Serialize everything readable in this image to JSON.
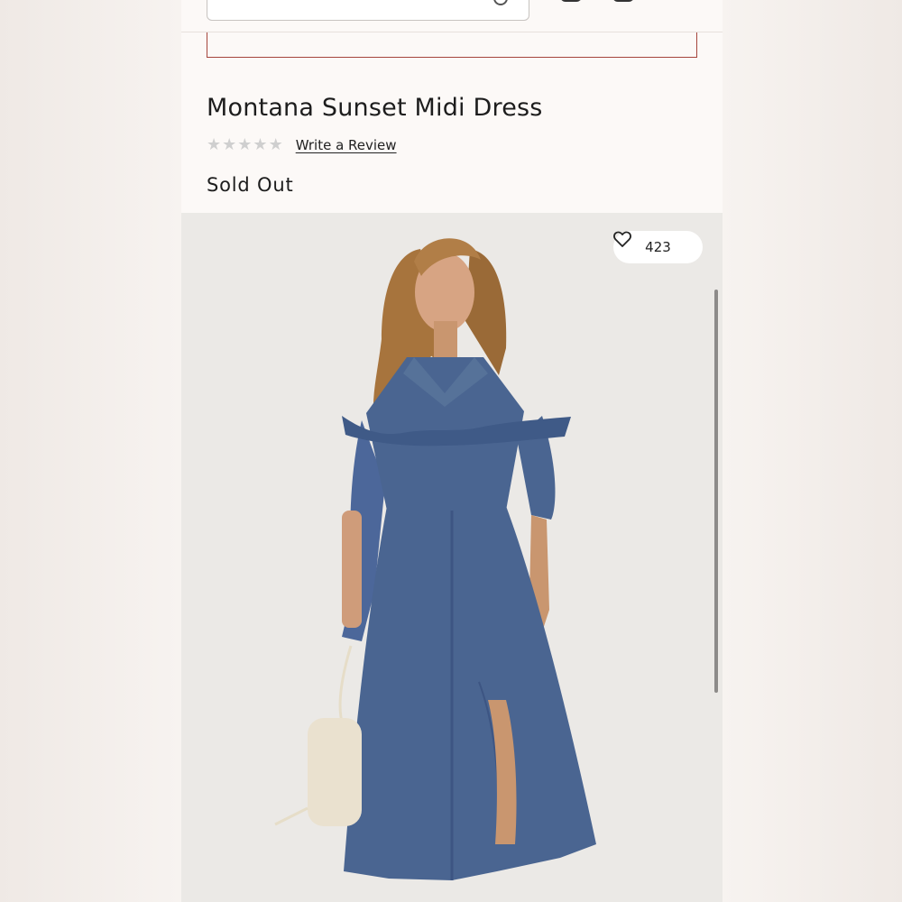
{
  "header": {
    "search": {
      "visible_fragment": "...y... ...g...",
      "icon": "search-icon"
    },
    "icons": [
      "bag-icon",
      "account-icon"
    ]
  },
  "product": {
    "title": "Montana Sunset Midi Dress",
    "rating": {
      "stars": 0,
      "max": 5,
      "star_color": "#cfcfcf"
    },
    "review_link": "Write a Review",
    "status": "Sold Out"
  },
  "image": {
    "like_count": "423",
    "like_icon": "heart-icon",
    "subject": "model-in-denim-shirt-dress"
  },
  "colors": {
    "accent_border": "#a5453c",
    "denim": "#4a6591",
    "background": "#fcf9f7"
  }
}
